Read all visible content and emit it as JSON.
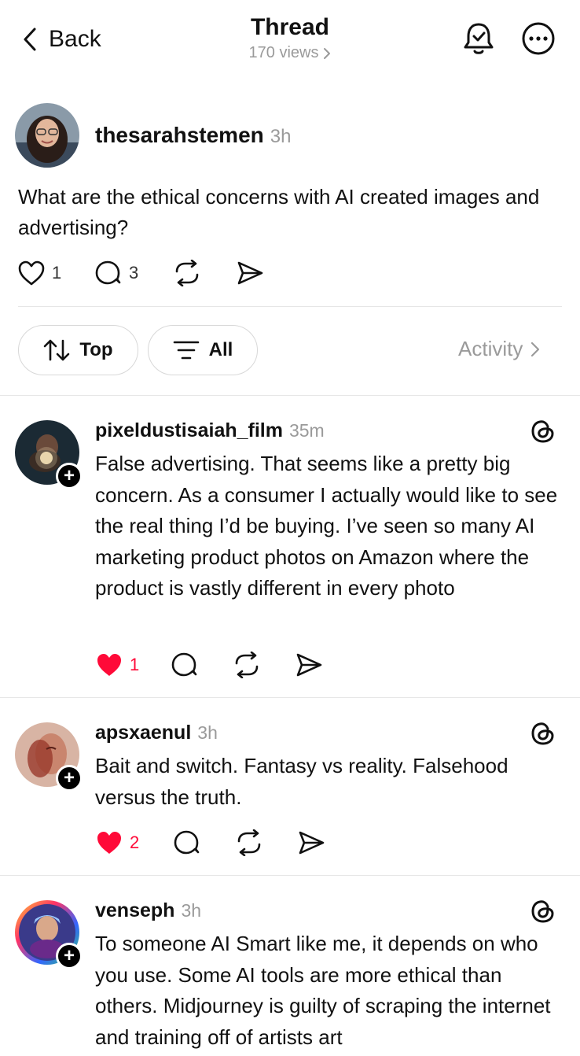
{
  "header": {
    "back_label": "Back",
    "title": "Thread",
    "views": "170 views"
  },
  "post": {
    "username": "thesarahstemen",
    "time": "3h",
    "text": "What are the ethical concerns with AI created images and advertising?",
    "likes": "1",
    "replies": "3"
  },
  "filters": {
    "sort_label": "Top",
    "filter_label": "All",
    "activity_label": "Activity"
  },
  "replies": [
    {
      "username": "pixeldustisaiah_film",
      "time": "35m",
      "text": "False advertising. That seems like a pretty big concern. As a consumer I actually would like to see the real thing I’d be buying. I’ve seen so many AI marketing product photos on Amazon where the product is vastly different in every photo",
      "likes": "1",
      "liked": true
    },
    {
      "username": "apsxaenul",
      "time": "3h",
      "text": "Bait and switch. Fantasy vs reality.  Falsehood versus the truth.",
      "likes": "2",
      "liked": true
    },
    {
      "username": "venseph",
      "time": "3h",
      "text": "To someone AI Smart like me, it depends on who you use.  Some AI tools are more ethical than others.  Midjourney is guilty of scraping the internet and training off of artists art"
    }
  ],
  "colors": {
    "like_red": "#ff0a38",
    "muted_text": "#9a9a9a",
    "divider": "#e6e6e6"
  }
}
